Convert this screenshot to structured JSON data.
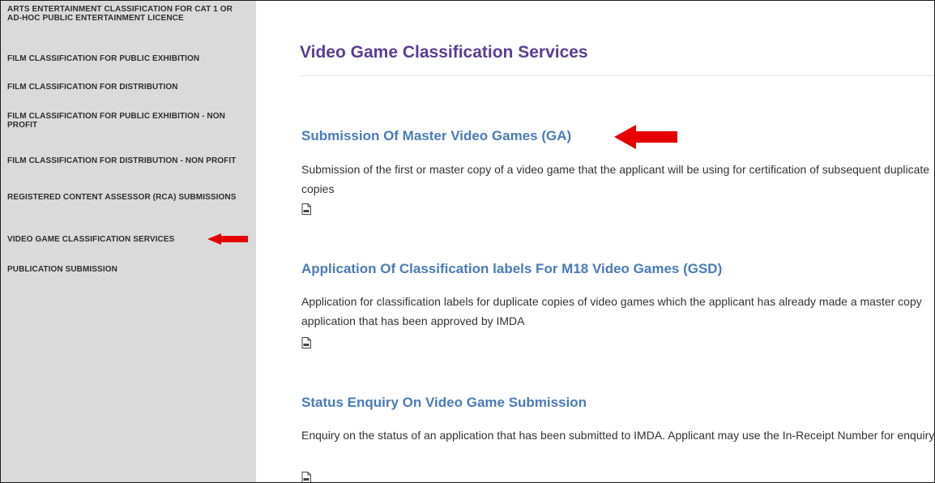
{
  "sidebar": {
    "items": [
      {
        "label": "ARTS ENTERTAINMENT CLASSIFICATION FOR CAT 1 OR AD-HOC PUBLIC ENTERTAINMENT LICENCE"
      },
      {
        "label": "FILM CLASSIFICATION FOR PUBLIC EXHIBITION"
      },
      {
        "label": "FILM CLASSIFICATION FOR DISTRIBUTION"
      },
      {
        "label": "FILM CLASSIFICATION FOR PUBLIC EXHIBITION - NON PROFIT"
      },
      {
        "label": "FILM CLASSIFICATION FOR DISTRIBUTION - NON PROFIT"
      },
      {
        "label": "REGISTERED CONTENT ASSESSOR (RCA) SUBMISSIONS"
      },
      {
        "label": "VIDEO GAME CLASSIFICATION SERVICES"
      },
      {
        "label": "PUBLICATION SUBMISSION"
      }
    ]
  },
  "main": {
    "title": "Video Game Classification Services",
    "services": [
      {
        "title": "Submission Of Master Video Games (GA)",
        "description": "Submission of the first or master copy of a video game that the applicant will be using for certification of subsequent duplicate copies"
      },
      {
        "title": "Application Of Classification labels For M18 Video Games (GSD)",
        "description": "Application for classification labels for duplicate copies of video games which the applicant has already made a master copy application that has been approved by IMDA"
      },
      {
        "title": "Status Enquiry On Video Game Submission",
        "description": "Enquiry on the status of an application that has been submitted to IMDA. Applicant may use the In-Receipt Number for enquiry."
      }
    ]
  },
  "colors": {
    "sidebar_bg": "#dadada",
    "title": "#5a3d94",
    "link": "#4a7bb8",
    "arrow": "#e60000"
  },
  "icons": {
    "document": "pdf-document-icon",
    "annotation": "red-arrow-icon"
  }
}
